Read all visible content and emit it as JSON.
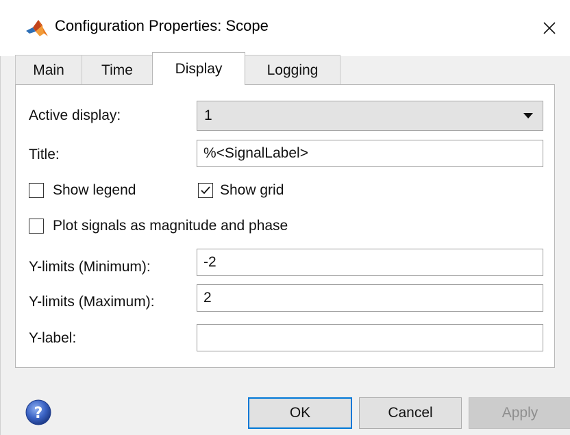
{
  "window": {
    "title": "Configuration Properties: Scope",
    "logo_icon": "matlab-logo-icon",
    "close_icon": "close-icon"
  },
  "tabs": [
    {
      "label": "Main",
      "active": false
    },
    {
      "label": "Time",
      "active": false
    },
    {
      "label": "Display",
      "active": true
    },
    {
      "label": "Logging",
      "active": false
    }
  ],
  "display": {
    "active_display_label": "Active display:",
    "active_display_value": "1",
    "title_label": "Title:",
    "title_value": "%<SignalLabel>",
    "show_legend_label": "Show legend",
    "show_legend_checked": false,
    "show_grid_label": "Show grid",
    "show_grid_checked": true,
    "magnitude_phase_label": "Plot signals as magnitude and phase",
    "magnitude_phase_checked": false,
    "ymin_label": "Y-limits (Minimum):",
    "ymin_value": "-2",
    "ymax_label": "Y-limits (Maximum):",
    "ymax_value": "2",
    "ylabel_label": "Y-label:",
    "ylabel_value": ""
  },
  "buttons": {
    "ok": "OK",
    "cancel": "Cancel",
    "apply": "Apply",
    "help_icon": "help-icon"
  },
  "colors": {
    "accent": "#0078d7",
    "help_blue": "#3b63c4"
  }
}
